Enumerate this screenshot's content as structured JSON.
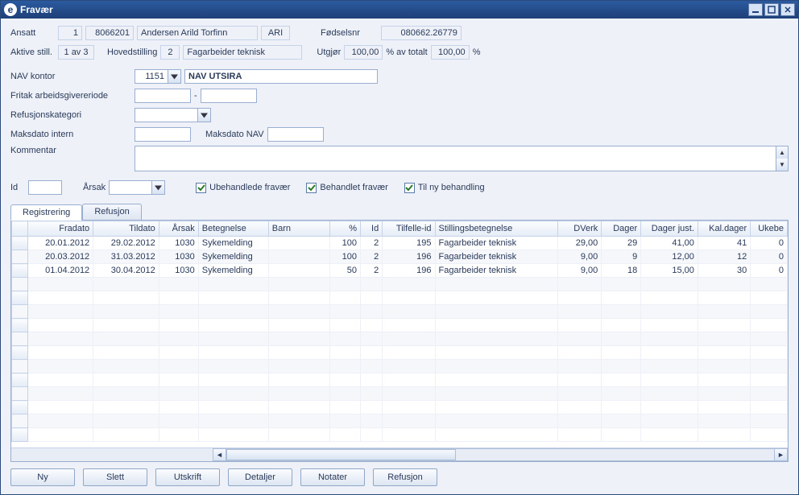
{
  "window": {
    "title": "Fravær"
  },
  "header": {
    "ansatt_label": "Ansatt",
    "ansatt_id": "1",
    "ansatt_no": "8066201",
    "ansatt_name": "Andersen Arild Torfinn",
    "ansatt_init": "ARI",
    "fodselsnr_label": "Fødselsnr",
    "fodselsnr": "080662.26779",
    "aktive_label": "Aktive still.",
    "aktive_val": "1 av 3",
    "hovedstilling_label": "Hovedstilling",
    "hovedstilling_no": "2",
    "hovedstilling_name": "Fagarbeider teknisk",
    "utgjor_label": "Utgjør",
    "utgjor_val": "100,00",
    "pct_total_label": "% av totalt",
    "pct_total_val": "100,00",
    "pct_sign": "%"
  },
  "form": {
    "nav_kontor_label": "NAV kontor",
    "nav_kontor_code": "1151",
    "nav_kontor_name": "NAV UTSIRA",
    "fritak_label": "Fritak arbeidsgivereriode",
    "fritak_sep": "-",
    "refusjon_label": "Refusjonskategori",
    "maksdato_intern_label": "Maksdato intern",
    "maksdato_nav_label": "Maksdato NAV",
    "kommentar_label": "Kommentar",
    "id_label": "Id",
    "arsak_label": "Årsak",
    "cb_ubehandlede": "Ubehandlede fravær",
    "cb_behandlet": "Behandlet fravær",
    "cb_tilny": "Til ny behandling"
  },
  "tabs": {
    "registrering": "Registrering",
    "refusjon": "Refusjon"
  },
  "grid": {
    "columns": {
      "fradato": "Fradato",
      "tildato": "Tildato",
      "arsak": "Årsak",
      "betegnelse": "Betegnelse",
      "barn": "Barn",
      "pct": "%",
      "id": "Id",
      "tilfelle": "Tilfelle-id",
      "stilling": "Stillingsbetegnelse",
      "dverk": "DVerk",
      "dager": "Dager",
      "dagerjust": "Dager just.",
      "kaldager": "Kal.dager",
      "ukebel": "Ukebe"
    },
    "rows": [
      {
        "fradato": "20.01.2012",
        "tildato": "29.02.2012",
        "arsak": "1030",
        "betegnelse": "Sykemelding",
        "barn": "",
        "pct": "100",
        "id": "2",
        "tilfelle": "195",
        "stilling": "Fagarbeider teknisk",
        "dverk": "29,00",
        "dager": "29",
        "dagerjust": "41,00",
        "kaldager": "41",
        "ukebel": "0"
      },
      {
        "fradato": "20.03.2012",
        "tildato": "31.03.2012",
        "arsak": "1030",
        "betegnelse": "Sykemelding",
        "barn": "",
        "pct": "100",
        "id": "2",
        "tilfelle": "196",
        "stilling": "Fagarbeider teknisk",
        "dverk": "9,00",
        "dager": "9",
        "dagerjust": "12,00",
        "kaldager": "12",
        "ukebel": "0"
      },
      {
        "fradato": "01.04.2012",
        "tildato": "30.04.2012",
        "arsak": "1030",
        "betegnelse": "Sykemelding",
        "barn": "",
        "pct": "50",
        "id": "2",
        "tilfelle": "196",
        "stilling": "Fagarbeider teknisk",
        "dverk": "9,00",
        "dager": "18",
        "dagerjust": "15,00",
        "kaldager": "30",
        "ukebel": "0"
      }
    ]
  },
  "buttons": {
    "ny": "Ny",
    "slett": "Slett",
    "utskrift": "Utskrift",
    "detaljer": "Detaljer",
    "notater": "Notater",
    "refusjon": "Refusjon"
  }
}
